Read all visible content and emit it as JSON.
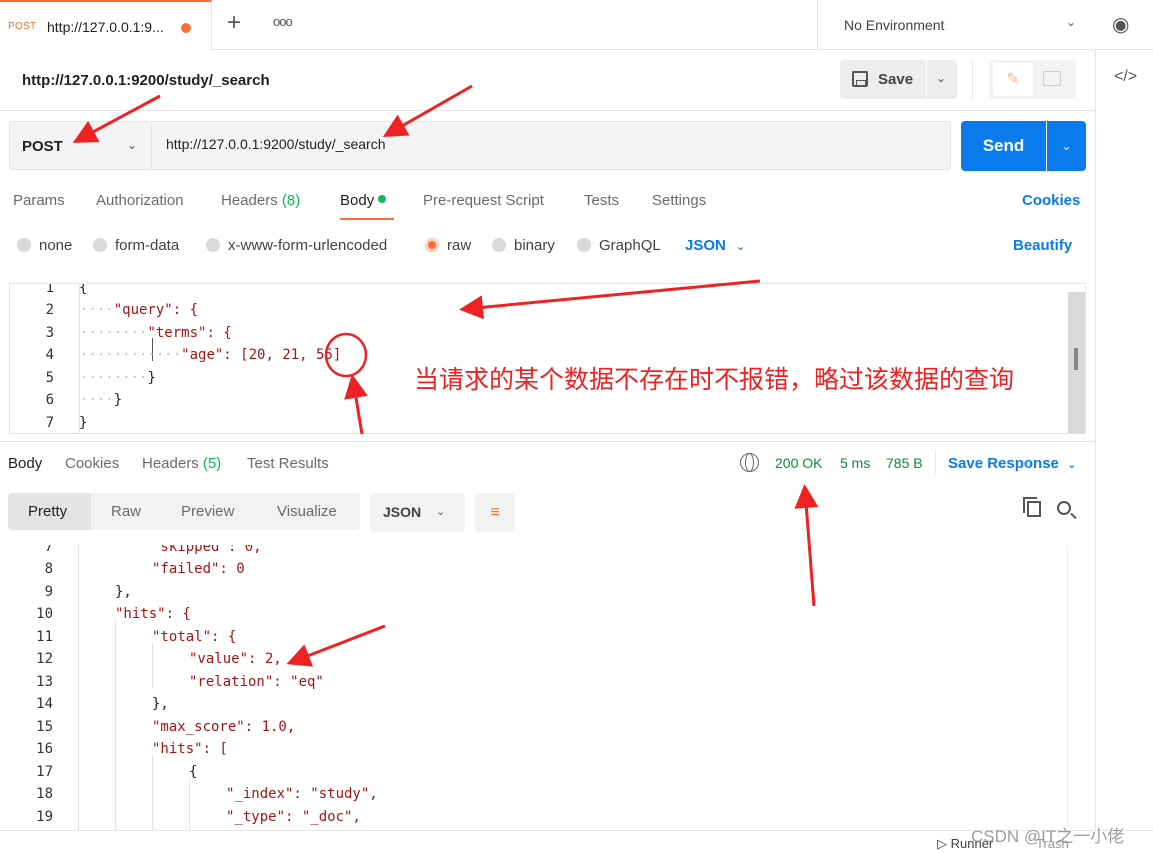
{
  "tab": {
    "method": "POST",
    "title": "http://127.0.0.1:9...",
    "new_tab": "+",
    "more": "ooo"
  },
  "environment": {
    "label": "No Environment"
  },
  "request": {
    "name": "http://127.0.0.1:9200/study/_search",
    "save_label": "Save",
    "method": "POST",
    "url": "http://127.0.0.1:9200/study/_search",
    "send_label": "Send"
  },
  "request_tabs": [
    {
      "label": "Params",
      "count": ""
    },
    {
      "label": "Authorization",
      "count": ""
    },
    {
      "label": "Headers",
      "count": "(8)"
    },
    {
      "label": "Body",
      "count": ""
    },
    {
      "label": "Pre-request Script",
      "count": ""
    },
    {
      "label": "Tests",
      "count": ""
    },
    {
      "label": "Settings",
      "count": ""
    }
  ],
  "cookies_label": "Cookies",
  "body_types": [
    "none",
    "form-data",
    "x-www-form-urlencoded",
    "raw",
    "binary",
    "GraphQL"
  ],
  "body_format": "JSON",
  "beautify_label": "Beautify",
  "request_body_lines": [
    "{",
    "\"query\": {",
    "\"terms\": {",
    "\"age\": [20, 21, 55]",
    "}",
    "}",
    "}"
  ],
  "annotation": "当请求的某个数据不存在时不报错，略过该数据的查询",
  "response_tabs": [
    {
      "label": "Body",
      "count": ""
    },
    {
      "label": "Cookies",
      "count": ""
    },
    {
      "label": "Headers",
      "count": "(5)"
    },
    {
      "label": "Test Results",
      "count": ""
    }
  ],
  "response_status": {
    "status": "200 OK",
    "time": "5 ms",
    "size": "785 B",
    "save_response": "Save Response"
  },
  "response_views": [
    "Pretty",
    "Raw",
    "Preview",
    "Visualize"
  ],
  "response_format": "JSON",
  "response_body_lines": [
    {
      "n": "7",
      "t": "\"skipped\": 0,"
    },
    {
      "n": "8",
      "t": "\"failed\": 0"
    },
    {
      "n": "9",
      "t": "},"
    },
    {
      "n": "10",
      "t": "\"hits\": {"
    },
    {
      "n": "11",
      "t": "\"total\": {"
    },
    {
      "n": "12",
      "t": "\"value\": 2,"
    },
    {
      "n": "13",
      "t": "\"relation\": \"eq\""
    },
    {
      "n": "14",
      "t": "},"
    },
    {
      "n": "15",
      "t": "\"max_score\": 1.0,"
    },
    {
      "n": "16",
      "t": "\"hits\": ["
    },
    {
      "n": "17",
      "t": "{"
    },
    {
      "n": "18",
      "t": "\"_index\": \"study\","
    },
    {
      "n": "19",
      "t": "\"_type\": \"_doc\","
    }
  ],
  "statusbar": {
    "runner": "Runner",
    "trash": "Trash"
  },
  "watermark": "CSDN @IT之一小佬",
  "colors": {
    "accent": "#ff6c37",
    "primary": "#097bed",
    "success": "#0cbb52",
    "annotation": "#ee2222"
  }
}
